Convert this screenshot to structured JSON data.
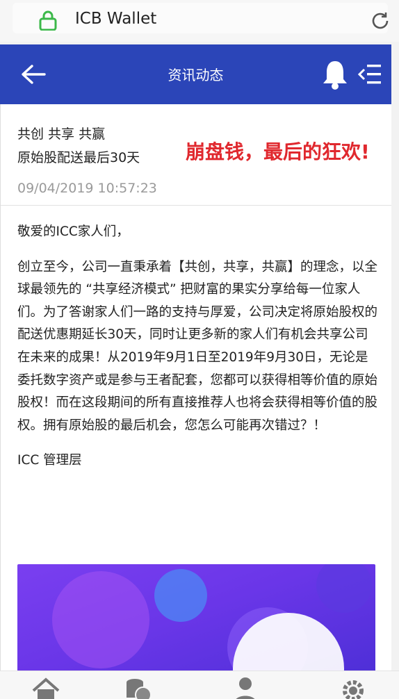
{
  "browser": {
    "url_title": "ICB Wallet"
  },
  "header": {
    "title": "资讯动态"
  },
  "article": {
    "title_line1": "共创 共享 共赢",
    "title_line2": "原始股配送最后30天",
    "datetime": "09/04/2019 10:57:23",
    "overlay_note": "崩盘钱，最后的狂欢!",
    "greeting": "敬爱的ICC家人们，",
    "paragraph": "创立至今，公司一直秉承着【共创，共享，共赢】的理念，以全球最领先的 “共享经济模式” 把财富的果实分享给每一位家人们。为了答谢家人们一路的支持与厚爱，公司决定将原始股权的配送优惠期延长30天，同时让更多新的家人们有机会共享公司在未来的成果！从2019年9月1日至2019年9月30日，无论是委托数字资产或是参与王者配套，您都可以获得相等价值的原始股权！而在这段期间的所有直接推荐人也将会获得相等价值的股权。拥有原始股的最后机会，您怎么可能再次错过？！",
    "signature": "ICC 管理层"
  },
  "colors": {
    "header_bg": "#2b45b8",
    "overlay_red": "#e0282e",
    "lock_green": "#3cb84a",
    "banner_purple": "#6a36e8"
  },
  "nav": {
    "items": [
      {
        "icon": "home-icon"
      },
      {
        "icon": "coins-icon"
      },
      {
        "icon": "user-icon"
      },
      {
        "icon": "gear-icon"
      }
    ]
  }
}
